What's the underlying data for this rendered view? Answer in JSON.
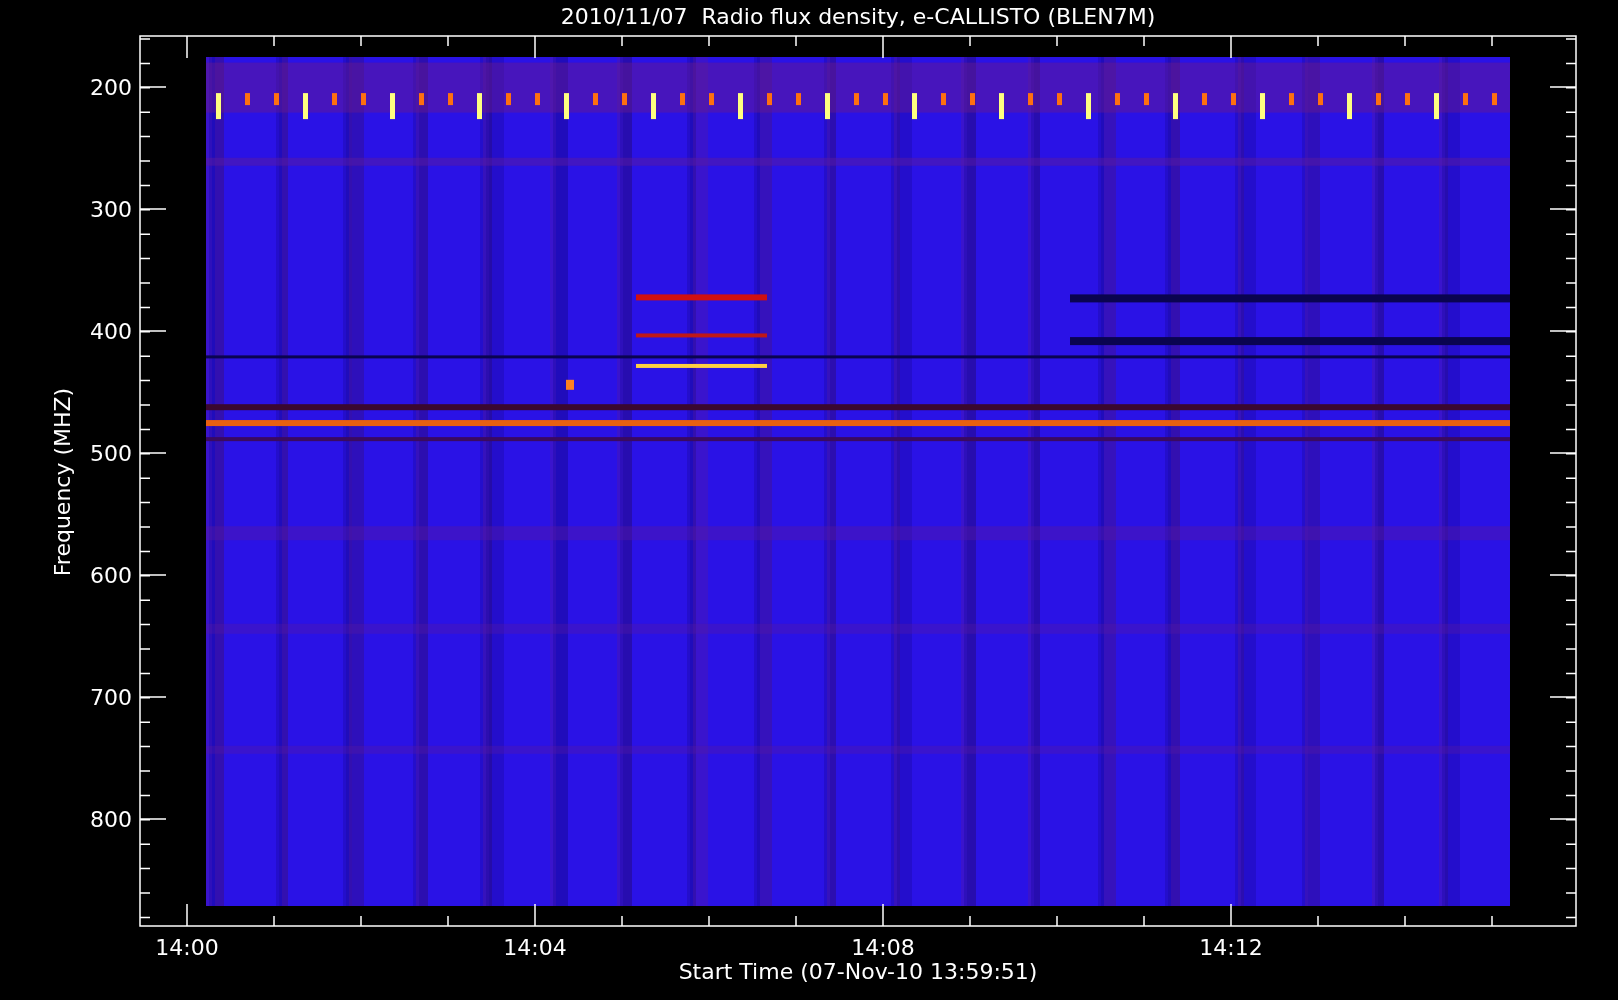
{
  "title": "2010/11/07  Radio flux density, e-CALLISTO (BLEN7M)",
  "ylabel": "Frequency (MHZ)",
  "xlabel": "Start Time (07-Nov-10 13:59:51)",
  "yticks": [
    "200",
    "300",
    "400",
    "500",
    "600",
    "700",
    "800"
  ],
  "xticks": [
    "14:00",
    "14:04",
    "14:08",
    "14:12"
  ]
}
